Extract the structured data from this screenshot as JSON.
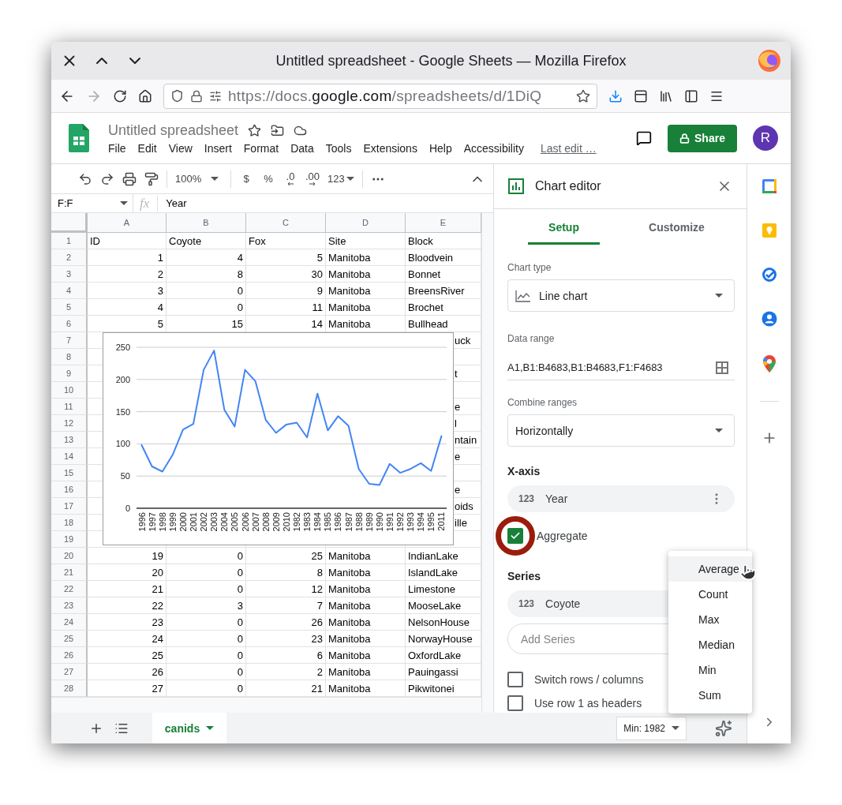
{
  "browser": {
    "title": "Untitled spreadsheet - Google Sheets — Mozilla Firefox",
    "url": "https://docs.**google.com**/spreadsheets/d/1DiQ"
  },
  "doc": {
    "title": "Untitled spreadsheet",
    "menu": [
      "File",
      "Edit",
      "View",
      "Insert",
      "Format",
      "Data",
      "Tools",
      "Extensions",
      "Help",
      "Accessibility"
    ],
    "last_edit": "Last edit …",
    "share": "Share",
    "avatar": "R"
  },
  "toolbar": {
    "zoom": "100%",
    "currency": "$",
    "percent": "%",
    "decimal_less": ".0",
    "decimal_more": ".00",
    "number_format": "123"
  },
  "formula_bar": {
    "name_box": "F:F",
    "fx": "fx",
    "value": "Year"
  },
  "grid": {
    "columns": [
      "A",
      "B",
      "C",
      "D",
      "E"
    ],
    "rows": [
      {
        "number": "1",
        "kind": "header",
        "cells": [
          "ID",
          "Coyote",
          "Fox",
          "Site",
          "Block"
        ]
      },
      {
        "number": "2",
        "kind": "data",
        "cells": [
          "1",
          "4",
          "5",
          "Manitoba",
          "Bloodvein"
        ]
      },
      {
        "number": "3",
        "kind": "data",
        "cells": [
          "2",
          "8",
          "30",
          "Manitoba",
          "Bonnet"
        ]
      },
      {
        "number": "4",
        "kind": "data",
        "cells": [
          "3",
          "0",
          "9",
          "Manitoba",
          "BreensRiver"
        ]
      },
      {
        "number": "5",
        "kind": "data",
        "cells": [
          "4",
          "0",
          "11",
          "Manitoba",
          "Brochet"
        ]
      },
      {
        "number": "6",
        "kind": "data",
        "cells": [
          "5",
          "15",
          "14",
          "Manitoba",
          "Bullhead"
        ]
      },
      {
        "number": "7",
        "kind": "covered",
        "tail": "uck"
      },
      {
        "number": "8",
        "kind": "covered"
      },
      {
        "number": "9",
        "kind": "covered",
        "tail": "t"
      },
      {
        "number": "10",
        "kind": "covered"
      },
      {
        "number": "11",
        "kind": "covered",
        "tail": "e"
      },
      {
        "number": "12",
        "kind": "covered",
        "tail": "l"
      },
      {
        "number": "13",
        "kind": "covered",
        "tail": "ntain"
      },
      {
        "number": "14",
        "kind": "covered",
        "tail": "e"
      },
      {
        "number": "15",
        "kind": "covered"
      },
      {
        "number": "16",
        "kind": "covered",
        "tail": "e"
      },
      {
        "number": "17",
        "kind": "covered",
        "tail": "oids"
      },
      {
        "number": "18",
        "kind": "covered",
        "tail": "ille"
      },
      {
        "number": "19",
        "kind": "covered"
      },
      {
        "number": "20",
        "kind": "data",
        "cells": [
          "19",
          "0",
          "25",
          "Manitoba",
          "IndianLake"
        ]
      },
      {
        "number": "21",
        "kind": "data",
        "cells": [
          "20",
          "0",
          "8",
          "Manitoba",
          "IslandLake"
        ]
      },
      {
        "number": "22",
        "kind": "data",
        "cells": [
          "21",
          "0",
          "12",
          "Manitoba",
          "Limestone"
        ]
      },
      {
        "number": "23",
        "kind": "data",
        "cells": [
          "22",
          "3",
          "7",
          "Manitoba",
          "MooseLake"
        ]
      },
      {
        "number": "24",
        "kind": "data",
        "cells": [
          "23",
          "0",
          "26",
          "Manitoba",
          "NelsonHouse"
        ]
      },
      {
        "number": "25",
        "kind": "data",
        "cells": [
          "24",
          "0",
          "23",
          "Manitoba",
          "NorwayHouse"
        ]
      },
      {
        "number": "26",
        "kind": "data",
        "cells": [
          "25",
          "0",
          "6",
          "Manitoba",
          "OxfordLake"
        ]
      },
      {
        "number": "27",
        "kind": "data",
        "cells": [
          "26",
          "0",
          "2",
          "Manitoba",
          "Pauingassi"
        ]
      },
      {
        "number": "28",
        "kind": "data",
        "cells": [
          "27",
          "0",
          "21",
          "Manitoba",
          "Pikwitonei"
        ]
      }
    ],
    "chart_data": {
      "type": "line",
      "categories": [
        "1996",
        "1997",
        "1998",
        "1999",
        "2000",
        "2001",
        "2002",
        "2003",
        "2004",
        "2005",
        "2006",
        "2007",
        "2008",
        "2009",
        "2010",
        "1982",
        "1983",
        "1984",
        "1985",
        "1986",
        "1987",
        "1988",
        "1989",
        "1990",
        "1991",
        "1992",
        "1993",
        "1994",
        "1995",
        "2011"
      ],
      "series": [
        {
          "color": "#4285f4",
          "values": [
            98,
            65,
            57,
            83,
            122,
            131,
            215,
            245,
            153,
            127,
            215,
            197,
            137,
            117,
            130,
            133,
            110,
            178,
            121,
            143,
            128,
            61,
            38,
            36,
            69,
            55,
            61,
            70,
            58,
            112
          ]
        }
      ],
      "ylim": [
        0,
        250
      ],
      "yticks": [
        0,
        50,
        100,
        150,
        200,
        250
      ],
      "grid": true
    }
  },
  "sheet_tabs": [
    {
      "label": "canids",
      "selected": true
    }
  ],
  "status": {
    "summary": "Min: 1982"
  },
  "chart_editor": {
    "title": "Chart editor",
    "tabs": [
      {
        "label": "Setup",
        "selected": true
      },
      {
        "label": "Customize",
        "selected": false
      }
    ],
    "chart_type": {
      "label": "Chart type",
      "value": "Line chart"
    },
    "data_range": {
      "label": "Data range",
      "value": "A1,B1:B4683,B1:B4683,F1:F4683"
    },
    "combine": {
      "label": "Combine ranges",
      "value": "Horizontally"
    },
    "x_axis": {
      "heading": "X-axis",
      "chip": {
        "type": "123",
        "label": "Year"
      },
      "aggregate": {
        "label": "Aggregate",
        "checked": true,
        "highlighted": true
      }
    },
    "series": {
      "heading": "Series",
      "chips": [
        {
          "type": "123",
          "label": "Coyote"
        }
      ],
      "placeholder": "Add Series"
    },
    "options": [
      {
        "label": "Switch rows / columns",
        "checked": false
      },
      {
        "label": "Use row 1 as headers",
        "checked": false
      }
    ],
    "aggregate_menu": [
      {
        "label": "Average",
        "selected": true
      },
      {
        "label": "Count",
        "selected": false
      },
      {
        "label": "Max",
        "selected": false
      },
      {
        "label": "Median",
        "selected": false
      },
      {
        "label": "Min",
        "selected": false
      },
      {
        "label": "Sum",
        "selected": false
      }
    ]
  }
}
